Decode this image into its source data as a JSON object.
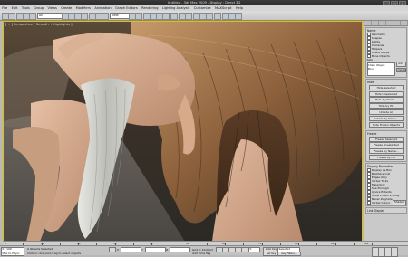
{
  "window": {
    "title": "Untitled - 3ds Max 2009 - Display : Direct 3D",
    "buttons": [
      "_",
      "□",
      "×"
    ]
  },
  "menubar": {
    "items": [
      "File",
      "Edit",
      "Tools",
      "Group",
      "Views",
      "Create",
      "Modifiers",
      "Animation",
      "Graph Editors",
      "Rendering",
      "Lighting Analysis",
      "Customize",
      "MAXScript",
      "Help"
    ]
  },
  "toolbar": {
    "selection_filter": "All",
    "view_dropdown": "View"
  },
  "viewport": {
    "label": "[ + ] Perspective [ Smooth + Highlights ]"
  },
  "command_panel": {
    "header": "Name",
    "rollouts": [
      "Geometry",
      "Shapes",
      "Lights",
      "Cameras",
      "Helpers",
      "Space Warps",
      "Bone Objects"
    ],
    "group_label": "Sets",
    "list_items": [
      "Chain Object",
      "Point"
    ],
    "side_buttons": [
      "Add",
      "Delete"
    ],
    "buttons": [
      "Hide",
      "Hide Selected",
      "Hide Unselected",
      "Hide by Name...",
      "Hide by Hit",
      "Unhide All",
      "Unhide by Name...",
      "Hide Frozen Objects",
      "Freeze",
      "Freeze Selected",
      "Freeze Unselected",
      "Freeze by Name...",
      "Freeze by Hit"
    ],
    "display_props_title": "Display Properties",
    "display_props": [
      "Display as Box",
      "Backface Cull",
      "Edges Only",
      "Vertex Ticks",
      "Trajectory",
      "See-Through",
      "Ignore Extents",
      "Show Frozen in Gray",
      "Never Degrade",
      "Vertex Colors"
    ],
    "shaded_label": "Shaded",
    "link_display_title": "Link Display"
  },
  "trackbar": {
    "labels": [
      "0",
      "10",
      "20",
      "30",
      "40",
      "50",
      "60",
      "70",
      "80",
      "90",
      "100"
    ]
  },
  "statusbar": {
    "frame_counter": "0 / 100",
    "mode": "Max to Physc",
    "status_text": "0 Objects Selected",
    "prompt_text": "Click or click-and-drag to select objects",
    "x_value": "",
    "y_value": "",
    "z_value": "",
    "grid_text": "Grid = 10.0mm",
    "add_time_tag": "Add Time Tag",
    "auto_key": "Auto Key",
    "set_key": "Set Key",
    "key_filter": "Selected",
    "key_filters_btn": "Key Filters...",
    "current_frame": "0"
  },
  "colors": {
    "viewport_border": "#e2c200",
    "ui_gray": "#c9c9c9"
  }
}
